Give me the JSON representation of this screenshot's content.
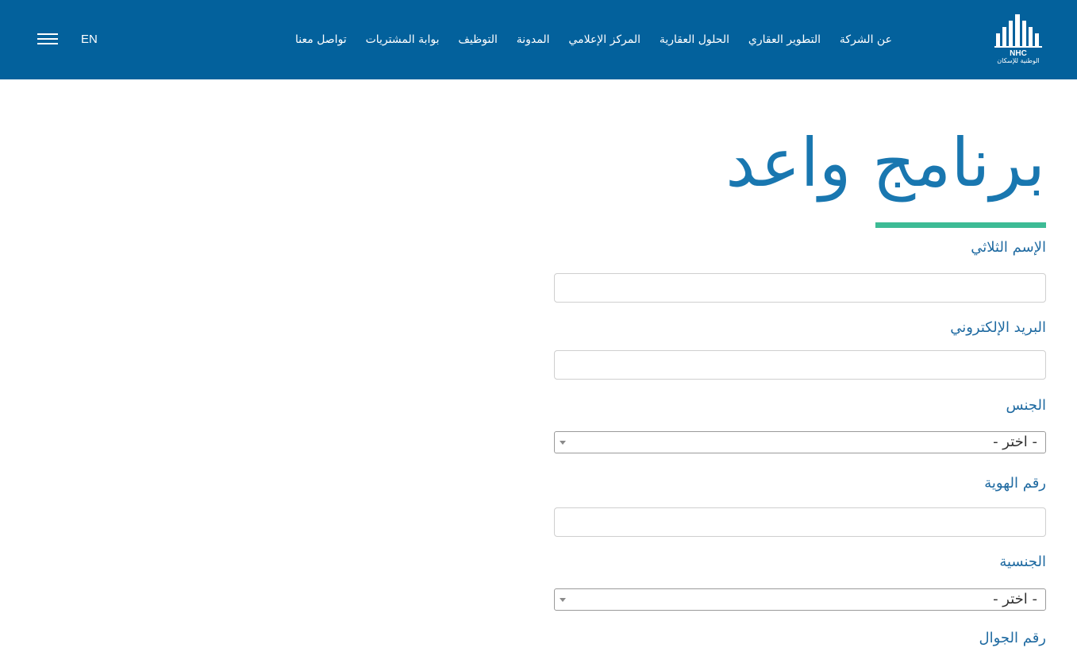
{
  "header": {
    "lang_toggle": "EN",
    "nav": [
      "عن الشركة",
      "التطوير العقاري",
      "الحلول العقارية",
      "المركز الإعلامي",
      "المدونة",
      "التوظيف",
      "بوابة المشتريات",
      "تواصل معنا"
    ],
    "logo_en": "NHC",
    "logo_ar": "الوطنية للإسكان"
  },
  "page": {
    "title": "برنامج واعد"
  },
  "form": {
    "full_name_label": "الإسم الثلاثي",
    "full_name_value": "",
    "email_label": "البريد الإلكتروني",
    "email_value": "",
    "gender_label": "الجنس",
    "gender_selected": "- اختر -",
    "id_number_label": "رقم الهوية",
    "id_number_value": "",
    "nationality_label": "الجنسية",
    "nationality_selected": "- اختر -",
    "mobile_label": "رقم الجوال"
  },
  "colors": {
    "header_bg": "#03619c",
    "title": "#1977b0",
    "label": "#1f6aa1",
    "accent": "#3dbb95"
  }
}
